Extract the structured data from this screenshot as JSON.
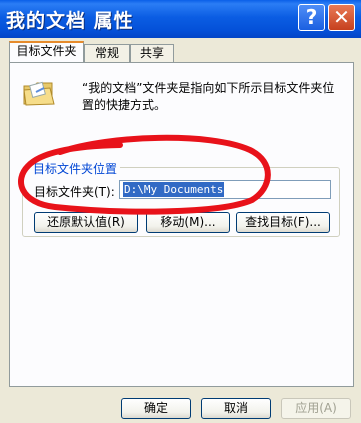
{
  "window": {
    "title": "我的文档 属性"
  },
  "titlebar": {
    "help_glyph": "?",
    "close_glyph": "✕"
  },
  "tabs": [
    {
      "label": "目标文件夹",
      "active": true
    },
    {
      "label": "常规",
      "active": false
    },
    {
      "label": "共享",
      "active": false
    }
  ],
  "description": "“我的文档”文件夹是指向如下所示目标文件夹位置的快捷方式。",
  "target_group": {
    "title": "目标文件夹位置",
    "field_label": "目标文件夹(T):",
    "field_value": "D:\\My Documents"
  },
  "actions": {
    "restore_default": "还原默认值(R)",
    "move": "移动(M)...",
    "find_target": "查找目标(F)..."
  },
  "footer": {
    "ok": "确定",
    "cancel": "取消",
    "apply": "应用(A)"
  },
  "annotation": {
    "color": "#e8121a"
  }
}
